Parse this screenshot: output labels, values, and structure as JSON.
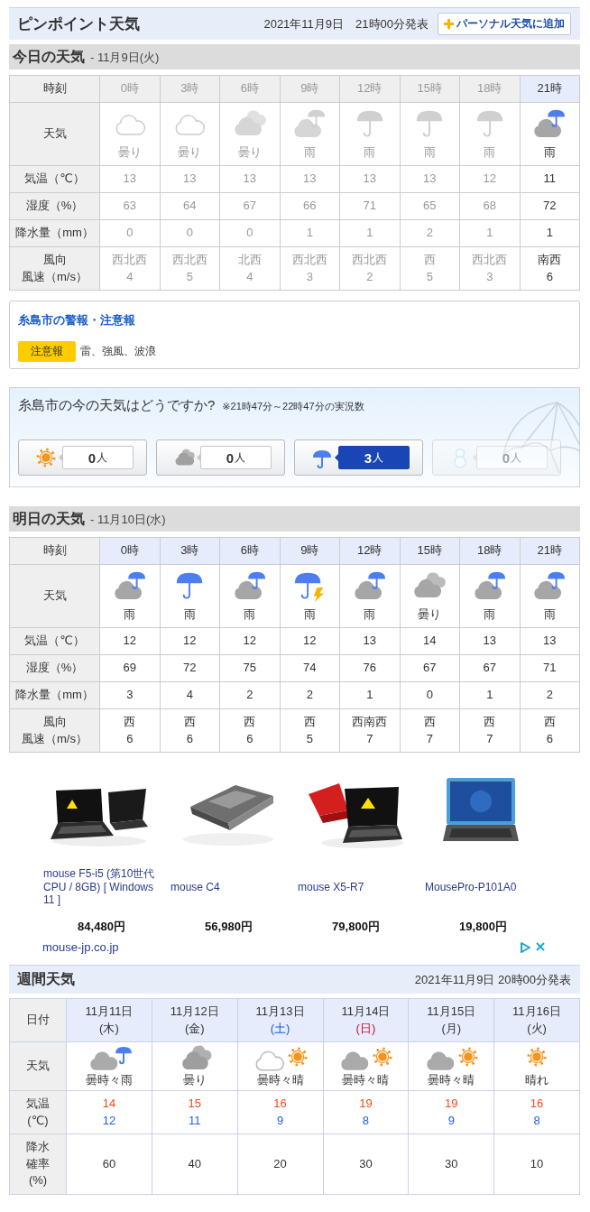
{
  "header": {
    "title": "ピンポイント天気",
    "issued": "2021年11月9日　21時00分発表",
    "add_button": "パーソナル天気に追加"
  },
  "today": {
    "heading": "今日の天気",
    "date": "- 11月9日(火)",
    "row_labels": [
      [
        "時刻"
      ],
      [
        "天気"
      ],
      [
        "気温（℃）"
      ],
      [
        "湿度（%）"
      ],
      [
        "降水量（mm）"
      ],
      [
        "風向",
        "風速（m/s）"
      ]
    ],
    "columns": [
      {
        "time": "0時",
        "past": true,
        "kind": "cloudy-thin",
        "weather": "曇り",
        "temp": "13",
        "humidity": "63",
        "precip": "0",
        "wind_dir": "西北西",
        "wind_speed": "4"
      },
      {
        "time": "3時",
        "past": true,
        "kind": "cloudy-thin",
        "weather": "曇り",
        "temp": "13",
        "humidity": "64",
        "precip": "0",
        "wind_dir": "西北西",
        "wind_speed": "5"
      },
      {
        "time": "6時",
        "past": true,
        "kind": "cloudy",
        "weather": "曇り",
        "temp": "13",
        "humidity": "67",
        "precip": "0",
        "wind_dir": "北西",
        "wind_speed": "4"
      },
      {
        "time": "9時",
        "past": true,
        "kind": "rain-cloudy",
        "weather": "雨",
        "temp": "13",
        "humidity": "66",
        "precip": "1",
        "wind_dir": "西北西",
        "wind_speed": "3"
      },
      {
        "time": "12時",
        "past": true,
        "kind": "rain",
        "weather": "雨",
        "temp": "13",
        "humidity": "71",
        "precip": "1",
        "wind_dir": "西北西",
        "wind_speed": "2"
      },
      {
        "time": "15時",
        "past": true,
        "kind": "rain",
        "weather": "雨",
        "temp": "13",
        "humidity": "65",
        "precip": "2",
        "wind_dir": "西",
        "wind_speed": "5"
      },
      {
        "time": "18時",
        "past": true,
        "kind": "rain",
        "weather": "雨",
        "temp": "12",
        "humidity": "68",
        "precip": "1",
        "wind_dir": "西北西",
        "wind_speed": "3"
      },
      {
        "time": "21時",
        "past": false,
        "kind": "rain-cloudy",
        "weather": "雨",
        "temp": "11",
        "humidity": "72",
        "precip": "1",
        "wind_dir": "南西",
        "wind_speed": "6"
      }
    ]
  },
  "warnings": {
    "title": "糸島市の警報・注意報",
    "items": [
      {
        "level": "注意報",
        "text": "雷、強風、波浪"
      }
    ]
  },
  "poll": {
    "question": "糸島市の今の天気はどうですか?",
    "note": "※21時47分～22時47分の実況数",
    "options": [
      {
        "kind": "sun",
        "count": "**0**人",
        "selected": false,
        "disabled": false
      },
      {
        "kind": "cloud",
        "count": "**0**人",
        "selected": false,
        "disabled": false
      },
      {
        "kind": "rain",
        "count": "**3**人",
        "selected": true,
        "disabled": false
      },
      {
        "kind": "snow",
        "count": "**0**人",
        "selected": false,
        "disabled": true
      }
    ]
  },
  "tomorrow": {
    "heading": "明日の天気",
    "date": "- 11月10日(水)",
    "row_labels": [
      [
        "時刻"
      ],
      [
        "天気"
      ],
      [
        "気温（℃）"
      ],
      [
        "湿度（%）"
      ],
      [
        "降水量（mm）"
      ],
      [
        "風向",
        "風速（m/s）"
      ]
    ],
    "columns": [
      {
        "time": "0時",
        "past": false,
        "kind": "rain-cloudy",
        "weather": "雨",
        "temp": "12",
        "humidity": "69",
        "precip": "3",
        "wind_dir": "西",
        "wind_speed": "6"
      },
      {
        "time": "3時",
        "past": false,
        "kind": "rain",
        "weather": "雨",
        "temp": "12",
        "humidity": "72",
        "precip": "4",
        "wind_dir": "西",
        "wind_speed": "6"
      },
      {
        "time": "6時",
        "past": false,
        "kind": "rain-cloudy",
        "weather": "雨",
        "temp": "12",
        "humidity": "75",
        "precip": "2",
        "wind_dir": "西",
        "wind_speed": "6"
      },
      {
        "time": "9時",
        "past": false,
        "kind": "thunder-rain",
        "weather": "雨",
        "temp": "12",
        "humidity": "74",
        "precip": "2",
        "wind_dir": "西",
        "wind_speed": "5"
      },
      {
        "time": "12時",
        "past": false,
        "kind": "rain-cloudy",
        "weather": "雨",
        "temp": "13",
        "humidity": "76",
        "precip": "1",
        "wind_dir": "西南西",
        "wind_speed": "7"
      },
      {
        "time": "15時",
        "past": false,
        "kind": "cloudy",
        "weather": "曇り",
        "temp": "14",
        "humidity": "67",
        "precip": "0",
        "wind_dir": "西",
        "wind_speed": "7"
      },
      {
        "time": "18時",
        "past": false,
        "kind": "rain-cloudy",
        "weather": "雨",
        "temp": "13",
        "humidity": "67",
        "precip": "1",
        "wind_dir": "西",
        "wind_speed": "7"
      },
      {
        "time": "21時",
        "past": false,
        "kind": "rain-cloudy",
        "weather": "雨",
        "temp": "13",
        "humidity": "71",
        "precip": "2",
        "wind_dir": "西",
        "wind_speed": "6"
      }
    ]
  },
  "ad": {
    "products": [
      {
        "kind": "picture",
        "name": "mouse F5-i5 (第10世代CPU / 8GB) [ Windows 11 ]",
        "price": "84,480円"
      },
      {
        "kind": "picture",
        "name": "mouse C4",
        "price": "56,980円"
      },
      {
        "kind": "picture",
        "name": "mouse X5-R7",
        "price": "79,800円"
      },
      {
        "kind": "picture",
        "name": "MousePro-P101A0",
        "price": "19,800円"
      }
    ],
    "source": "mouse-jp.co.jp"
  },
  "weekly": {
    "heading": "週間天気",
    "issued": "2021年11月9日 20時00分発表",
    "row_labels": [
      [
        "日付"
      ],
      [
        "天気"
      ],
      [
        "気温",
        "(℃)"
      ],
      [
        "降水確率",
        "(%)"
      ]
    ],
    "days": [
      {
        "date": "11月11日",
        "weekday": "(木)",
        "color": "#333333",
        "kind": "cloud-rain",
        "weather": "曇時々雨",
        "high": "14",
        "low": "12",
        "pop": "60"
      },
      {
        "date": "11月12日",
        "weekday": "(金)",
        "color": "#333333",
        "kind": "cloud",
        "weather": "曇り",
        "high": "15",
        "low": "11",
        "pop": "40"
      },
      {
        "date": "11月13日",
        "weekday": "(土)",
        "color": "#1a5cd8",
        "kind": "cloud-sun-pale",
        "weather": "曇時々晴",
        "high": "16",
        "low": "9",
        "pop": "20"
      },
      {
        "date": "11月14日",
        "weekday": "(日)",
        "color": "#c8102e",
        "kind": "cloud-sun",
        "weather": "曇時々晴",
        "high": "19",
        "low": "8",
        "pop": "30"
      },
      {
        "date": "11月15日",
        "weekday": "(月)",
        "color": "#333333",
        "kind": "cloud-sun",
        "weather": "曇時々晴",
        "high": "19",
        "low": "9",
        "pop": "30"
      },
      {
        "date": "11月16日",
        "weekday": "(火)",
        "color": "#333333",
        "kind": "sun",
        "weather": "晴れ",
        "high": "16",
        "low": "8",
        "pop": "10"
      }
    ]
  }
}
